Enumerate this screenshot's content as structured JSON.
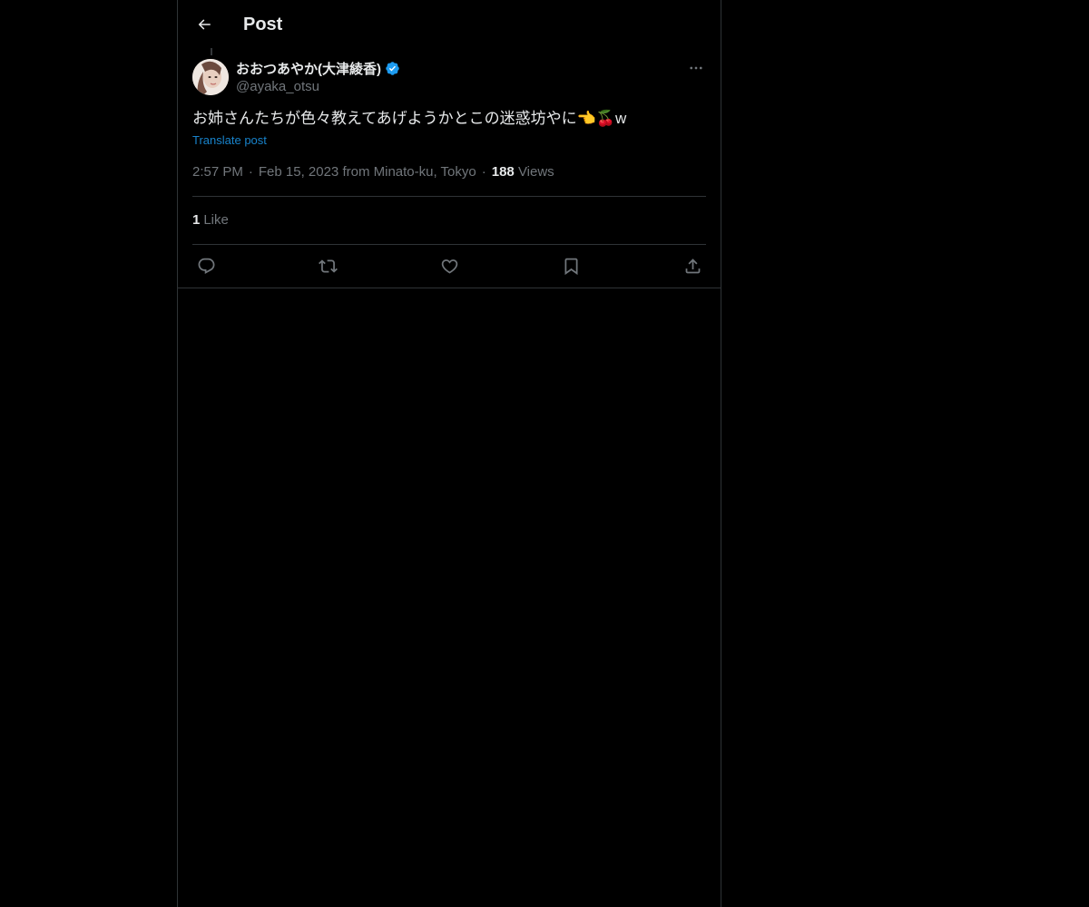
{
  "header": {
    "title": "Post",
    "back_icon": "arrow-left-icon"
  },
  "post": {
    "author": {
      "name": "おおつあやか(大津綾香)",
      "handle": "@ayaka_otsu",
      "verified": true,
      "verified_color": "#1d9bf0"
    },
    "text_main": "お姉さんたちが色々教えてあげようかとこの迷惑坊やに",
    "text_emoji": "👈🍒",
    "text_tail": "w",
    "translate_label": "Translate post",
    "time": "2:57 PM",
    "date": "Feb 15, 2023",
    "location": "from Minato-ku, Tokyo",
    "separator": "·",
    "views_count": "188",
    "views_label": "Views",
    "likes_count": "1",
    "likes_label": "Like"
  },
  "actions": {
    "reply_icon": "reply-icon",
    "repost_icon": "repost-icon",
    "like_icon": "heart-icon",
    "bookmark_icon": "bookmark-icon",
    "share_icon": "share-icon"
  },
  "colors": {
    "background": "#000000",
    "text": "#e7e9ea",
    "secondary": "#71767b",
    "border": "#2f3336",
    "accent": "#1d9bf0"
  }
}
